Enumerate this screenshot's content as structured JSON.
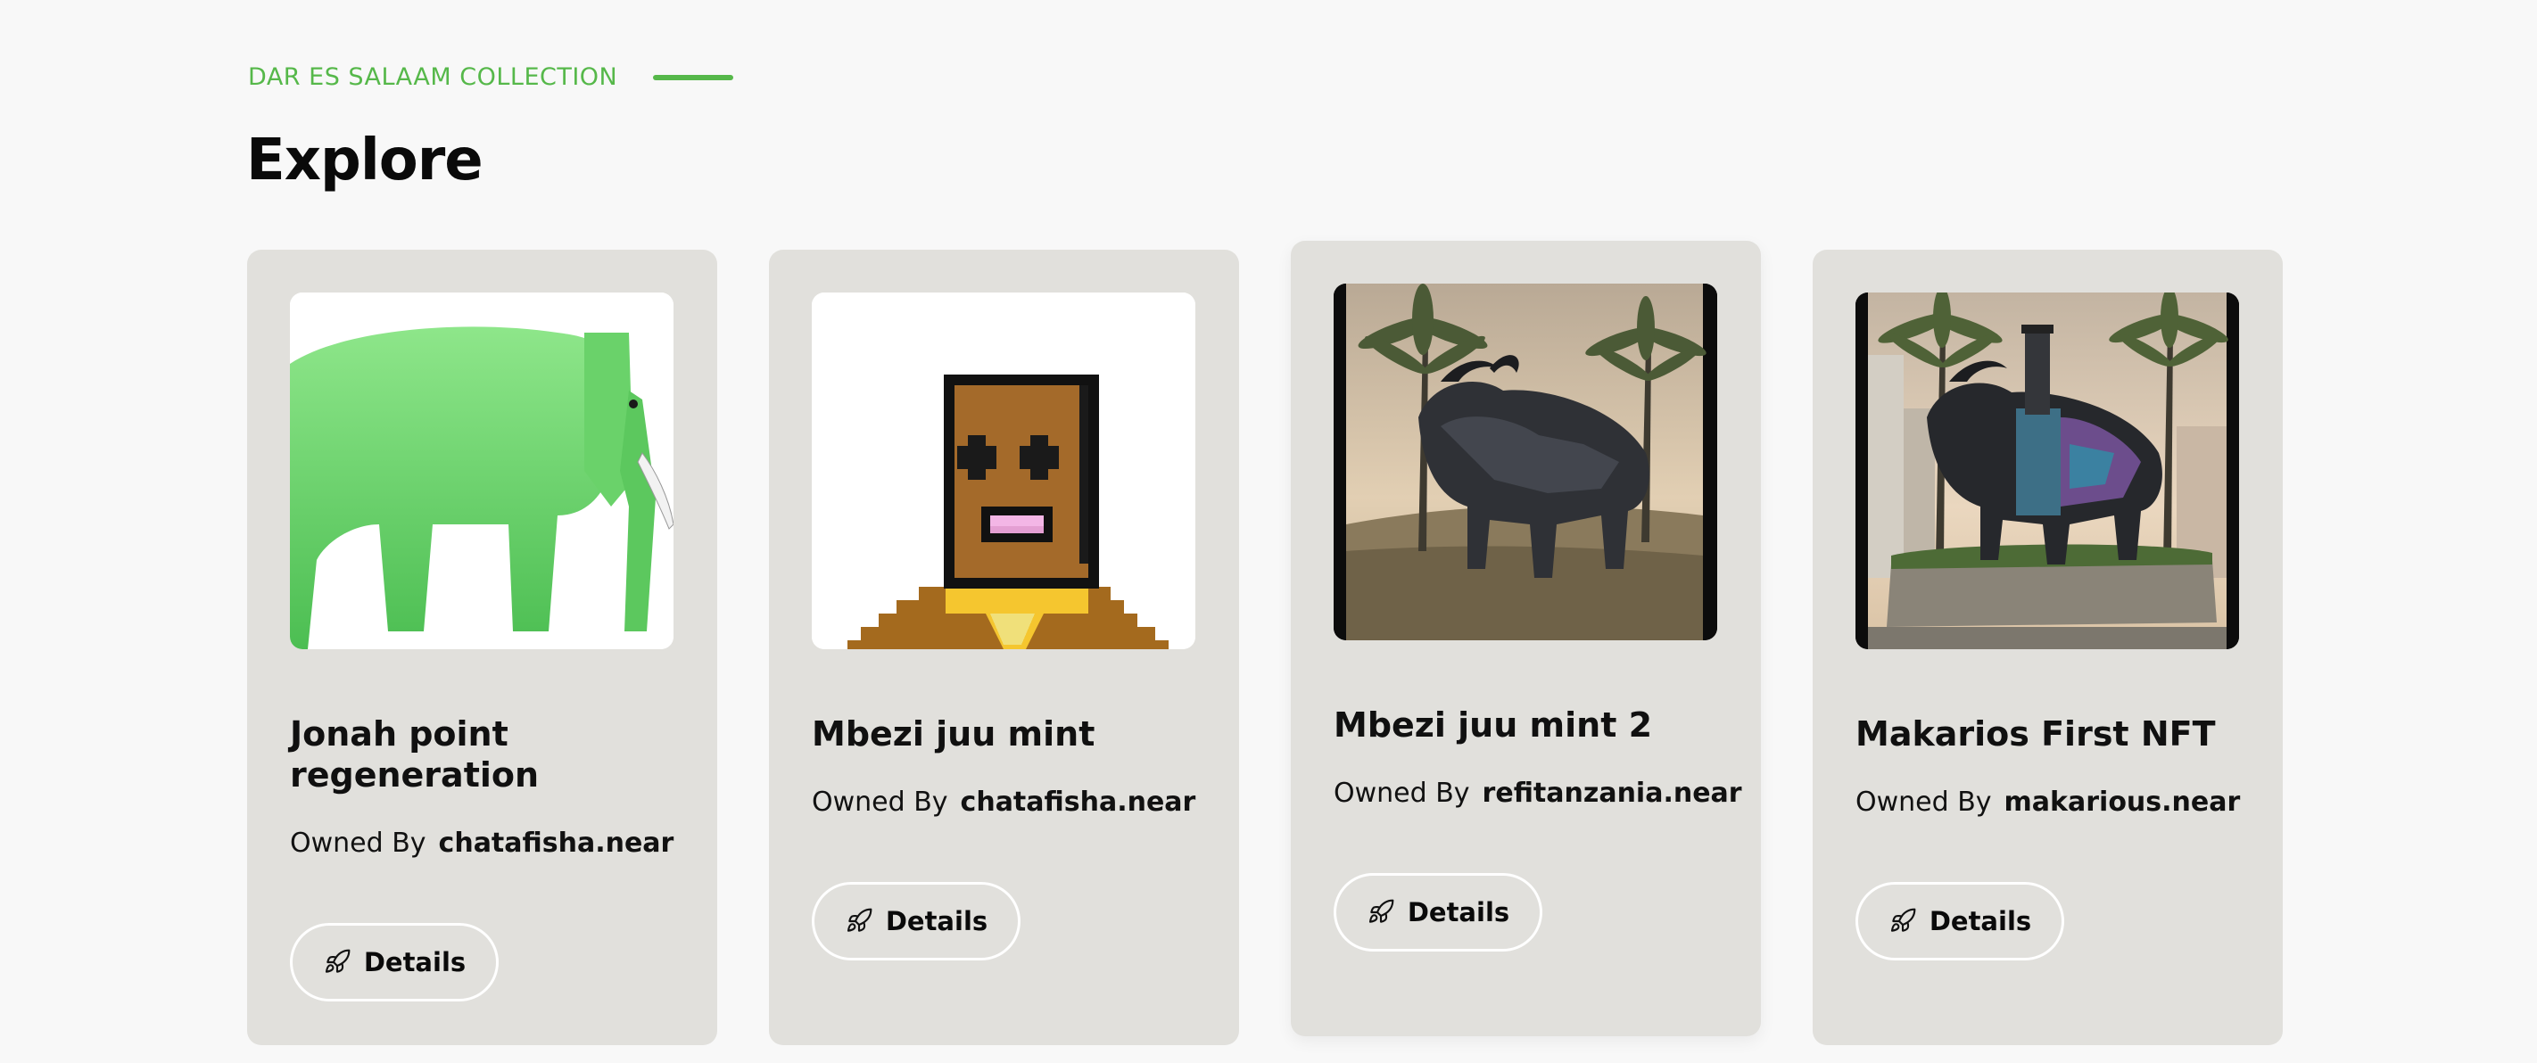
{
  "header": {
    "eyebrow": "DAR ES SALAAM COLLECTION",
    "title": "Explore"
  },
  "colors": {
    "accent": "#56b84a",
    "card_bg": "#e1e0dc",
    "page_bg": "#f8f8f8"
  },
  "cards": [
    {
      "title": "Jonah point regeneration",
      "owned_by_label": "Owned By",
      "owner": "chatafisha.near",
      "button_label": "Details",
      "button_icon": "rocket-icon",
      "image": "green elephant"
    },
    {
      "title": "Mbezi juu mint",
      "owned_by_label": "Owned By",
      "owner": "chatafisha.near",
      "button_label": "Details",
      "button_icon": "rocket-icon",
      "image": "pixel art face"
    },
    {
      "title": "Mbezi juu mint 2",
      "owned_by_label": "Owned By",
      "owner": "refitanzania.near",
      "button_label": "Details",
      "button_icon": "rocket-icon",
      "image": "buffalo statue with palms"
    },
    {
      "title": "Makarios First NFT",
      "owned_by_label": "Owned By",
      "owner": "makarious.near",
      "button_label": "Details",
      "button_icon": "rocket-icon",
      "image": "painted buffalo statue"
    }
  ]
}
